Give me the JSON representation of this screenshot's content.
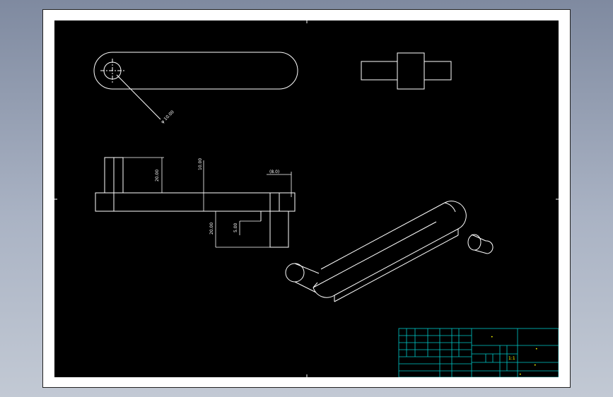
{
  "drawing": {
    "dimensions": {
      "hole_diameter": "φ 10.00",
      "boss_height": "20.00",
      "overall_height": "10.00",
      "offset_ref": "(8.0)",
      "lower_height": "20.00",
      "small_step": "5.00"
    }
  },
  "title_block": {
    "scale": "1:1",
    "notes": [
      "•",
      "•",
      "•",
      "•"
    ]
  },
  "colors": {
    "background": "#000000",
    "line": "#ffffff",
    "dimension": "#ffffff",
    "title_block_grid": "#00c8c8",
    "title_block_text": "#ffff00"
  }
}
